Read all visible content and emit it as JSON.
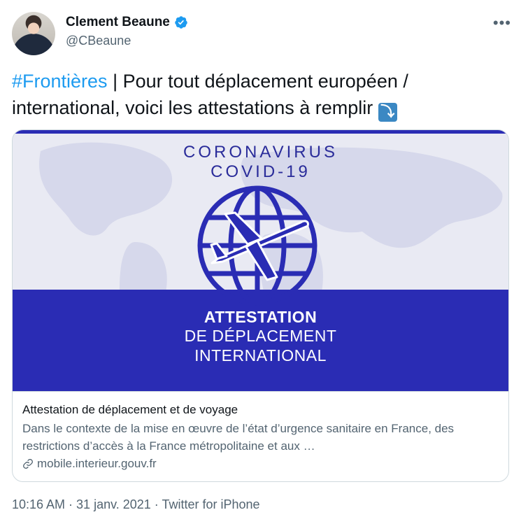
{
  "author": {
    "display_name": "Clement Beaune",
    "handle": "@CBeaune"
  },
  "tweet": {
    "hashtag": "#Frontières",
    "text": " | Pour tout déplacement européen / international, voici les attestations à remplir ",
    "emoji": "⤵"
  },
  "card": {
    "image": {
      "line1": "CORONAVIRUS",
      "line2": "COVID-19",
      "line3": "ATTESTATION",
      "line4": "DE DÉPLACEMENT",
      "line5": "INTERNATIONAL"
    },
    "title": "Attestation de déplacement et de voyage",
    "description": "Dans le contexte de la mise en œuvre de l’état d’urgence sanitaire en France, des restrictions d’accès à la France métropolitaine et aux …",
    "domain": "mobile.interieur.gouv.fr"
  },
  "footer": {
    "timestamp": "10:16 AM · 31 janv. 2021 · Twitter for iPhone"
  },
  "icons": [
    "verified-badge-icon",
    "more-options-icon",
    "link-icon",
    "airplane-icon",
    "globe-icon"
  ],
  "colors": {
    "link_blue": "#1d9bf0",
    "text": "#0f1419",
    "secondary": "#536471",
    "banner_blue": "#2a2cb4"
  }
}
